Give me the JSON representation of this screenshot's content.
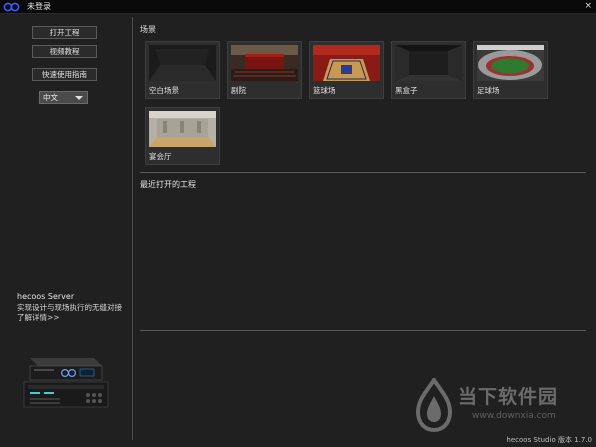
{
  "window": {
    "title": "未登录",
    "close_glyph": "×"
  },
  "sidebar": {
    "buttons": [
      "打开工程",
      "视频教程",
      "快速使用指南"
    ],
    "language": "中文",
    "server_title": "hecoos Server",
    "server_desc": "实现设计与现场执行的无缝对接",
    "server_link": "了解详情>>",
    "server_image_icon": "media-server-hardware-image"
  },
  "main": {
    "scenes_heading": "场景",
    "scenes": [
      {
        "label": "空白场景",
        "icon": "blank-scene-thumbnail"
      },
      {
        "label": "剧院",
        "icon": "theater-thumbnail"
      },
      {
        "label": "篮球场",
        "icon": "basketball-court-thumbnail"
      },
      {
        "label": "黑盒子",
        "icon": "black-box-thumbnail"
      },
      {
        "label": "足球场",
        "icon": "stadium-thumbnail"
      },
      {
        "label": "宴会厅",
        "icon": "banquet-hall-thumbnail"
      }
    ],
    "recent_heading": "最近打开的工程"
  },
  "footer": {
    "version": "hecoos Studio 版本 1.7.0"
  },
  "watermark": {
    "text": "当下软件园",
    "url": "www.downxia.com"
  },
  "colors": {
    "background": "#202020",
    "titlebar": "#0a0a0a",
    "card": "#2e2e2e",
    "accent": "#3a5cff"
  }
}
